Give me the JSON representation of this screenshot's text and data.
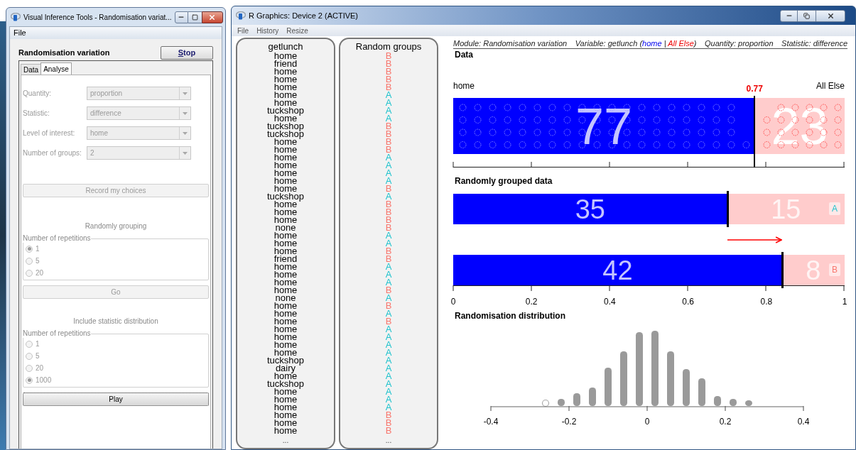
{
  "control_window": {
    "title": "Visual Inference Tools - Randomisation variat...",
    "menu": [
      "File"
    ],
    "heading": "Randomisation variation",
    "stop_button": "Stop",
    "tabs": [
      {
        "label": "Data",
        "selected": false
      },
      {
        "label": "Analyse",
        "selected": true
      }
    ],
    "fields": [
      {
        "label": "Quantity:",
        "value": "proportion",
        "disabled": true
      },
      {
        "label": "Statistic:",
        "value": "difference",
        "disabled": true
      },
      {
        "label": "Level of interest:",
        "value": "home",
        "disabled": true
      },
      {
        "label": "Number of groups:",
        "value": "2",
        "disabled": true
      }
    ],
    "record_button": {
      "label": "Record my choices",
      "disabled": true
    },
    "sections": [
      {
        "heading": "Randomly grouping",
        "group_label": "Number of repetitions",
        "options": [
          {
            "label": "1",
            "selected": true
          },
          {
            "label": "5",
            "selected": false
          },
          {
            "label": "20",
            "selected": false
          }
        ],
        "button": {
          "label": "Go",
          "disabled": true,
          "focused": false
        }
      },
      {
        "heading": "Include statistic distribution",
        "group_label": "Number of repetitions",
        "options": [
          {
            "label": "1",
            "selected": false
          },
          {
            "label": "5",
            "selected": false
          },
          {
            "label": "20",
            "selected": false
          },
          {
            "label": "1000",
            "selected": true
          }
        ],
        "button": {
          "label": "Play",
          "disabled": false,
          "focused": true
        }
      }
    ]
  },
  "graphics_window": {
    "title": "R Graphics: Device 2 (ACTIVE)",
    "menu": [
      "File",
      "History",
      "Resize"
    ],
    "variable_column": {
      "heading": "getlunch",
      "more": "..."
    },
    "group_column": {
      "heading": "Random groups",
      "more": "..."
    },
    "rows": [
      {
        "value": "home",
        "group": "B",
        "color": "#f8766d"
      },
      {
        "value": "friend",
        "group": "B",
        "color": "#f8766d"
      },
      {
        "value": "home",
        "group": "B",
        "color": "#f8766d"
      },
      {
        "value": "home",
        "group": "B",
        "color": "#f8766d"
      },
      {
        "value": "home",
        "group": "B",
        "color": "#f8766d"
      },
      {
        "value": "home",
        "group": "A",
        "color": "#1fc3cd"
      },
      {
        "value": "home",
        "group": "A",
        "color": "#1fc3cd"
      },
      {
        "value": "tuckshop",
        "group": "A",
        "color": "#1fc3cd"
      },
      {
        "value": "home",
        "group": "A",
        "color": "#1fc3cd"
      },
      {
        "value": "tuckshop",
        "group": "B",
        "color": "#f8766d"
      },
      {
        "value": "tuckshop",
        "group": "B",
        "color": "#f8766d"
      },
      {
        "value": "home",
        "group": "B",
        "color": "#f8766d"
      },
      {
        "value": "home",
        "group": "B",
        "color": "#f8766d"
      },
      {
        "value": "home",
        "group": "A",
        "color": "#1fc3cd"
      },
      {
        "value": "home",
        "group": "A",
        "color": "#1fc3cd"
      },
      {
        "value": "home",
        "group": "A",
        "color": "#1fc3cd"
      },
      {
        "value": "home",
        "group": "A",
        "color": "#1fc3cd"
      },
      {
        "value": "home",
        "group": "B",
        "color": "#f8766d"
      },
      {
        "value": "tuckshop",
        "group": "A",
        "color": "#1fc3cd"
      },
      {
        "value": "home",
        "group": "B",
        "color": "#f8766d"
      },
      {
        "value": "home",
        "group": "B",
        "color": "#f8766d"
      },
      {
        "value": "home",
        "group": "B",
        "color": "#f8766d"
      },
      {
        "value": "none",
        "group": "B",
        "color": "#f8766d"
      },
      {
        "value": "home",
        "group": "A",
        "color": "#1fc3cd"
      },
      {
        "value": "home",
        "group": "A",
        "color": "#1fc3cd"
      },
      {
        "value": "home",
        "group": "B",
        "color": "#f8766d"
      },
      {
        "value": "friend",
        "group": "B",
        "color": "#f8766d"
      },
      {
        "value": "home",
        "group": "A",
        "color": "#1fc3cd"
      },
      {
        "value": "home",
        "group": "A",
        "color": "#1fc3cd"
      },
      {
        "value": "home",
        "group": "A",
        "color": "#1fc3cd"
      },
      {
        "value": "home",
        "group": "B",
        "color": "#f8766d"
      },
      {
        "value": "none",
        "group": "A",
        "color": "#1fc3cd"
      },
      {
        "value": "home",
        "group": "B",
        "color": "#f8766d"
      },
      {
        "value": "home",
        "group": "A",
        "color": "#1fc3cd"
      },
      {
        "value": "home",
        "group": "B",
        "color": "#f8766d"
      },
      {
        "value": "home",
        "group": "A",
        "color": "#1fc3cd"
      },
      {
        "value": "home",
        "group": "A",
        "color": "#1fc3cd"
      },
      {
        "value": "home",
        "group": "A",
        "color": "#1fc3cd"
      },
      {
        "value": "home",
        "group": "A",
        "color": "#1fc3cd"
      },
      {
        "value": "tuckshop",
        "group": "A",
        "color": "#1fc3cd"
      },
      {
        "value": "dairy",
        "group": "A",
        "color": "#1fc3cd"
      },
      {
        "value": "home",
        "group": "A",
        "color": "#1fc3cd"
      },
      {
        "value": "tuckshop",
        "group": "A",
        "color": "#1fc3cd"
      },
      {
        "value": "home",
        "group": "A",
        "color": "#1fc3cd"
      },
      {
        "value": "home",
        "group": "A",
        "color": "#1fc3cd"
      },
      {
        "value": "home",
        "group": "A",
        "color": "#1fc3cd"
      },
      {
        "value": "home",
        "group": "B",
        "color": "#f8766d"
      },
      {
        "value": "home",
        "group": "B",
        "color": "#f8766d"
      },
      {
        "value": "home",
        "group": "B",
        "color": "#f8766d"
      }
    ],
    "plot": {
      "captions": {
        "module": "Module: Randomisation variation",
        "variable": {
          "prefix": "Variable: getlunch (",
          "level": "home",
          "separator": " | ",
          "other": "All Else",
          "suffix": ")"
        },
        "quantity": "Quantity: proportion",
        "statistic": "Statistic: difference"
      },
      "data": {
        "title": "Data",
        "left_label": "home",
        "right_label": "All Else",
        "marker_label": "0.77",
        "level": 0.77,
        "count_in": "77",
        "count_out": "23"
      },
      "grouped": {
        "title": "Randomly grouped data",
        "groups": [
          {
            "name": "A",
            "color": "#1fc3cd",
            "level": 0.7,
            "count_in": "35",
            "count_out": "15"
          },
          {
            "name": "B",
            "color": "#f8766d",
            "level": 0.84,
            "count_in": "42",
            "count_out": "8"
          }
        ],
        "ticks": [
          "0",
          "0.2",
          "0.4",
          "0.6",
          "0.8",
          "1"
        ]
      },
      "distribution": {
        "title": "Randomisation distribution",
        "ticks": [
          "-0.4",
          "-0.2",
          "0",
          "0.2",
          "0.4"
        ]
      }
    }
  }
}
